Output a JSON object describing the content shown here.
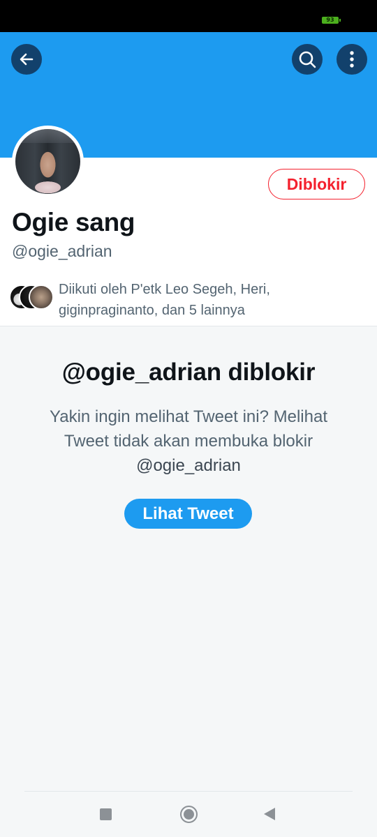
{
  "status_bar": {
    "battery_level": "93"
  },
  "colors": {
    "brand_blue": "#1d9bf0",
    "blocked_red": "#f4212e",
    "secondary_text": "#536471"
  },
  "header": {
    "back_icon": "arrow-left-icon",
    "search_icon": "search-icon",
    "more_icon": "more-vertical-icon"
  },
  "profile": {
    "display_name": "Ogie sang",
    "handle": "@ogie_adrian",
    "blocked_button_label": "Diblokir",
    "followed_by_text": "Diikuti oleh P'etk Leo Segeh, Heri, giginpraginanto, dan 5 lainnya"
  },
  "blocked_notice": {
    "title": "@ogie_adrian diblokir",
    "description": "Yakin ingin melihat Tweet ini? Melihat Tweet tidak akan membuka blokir",
    "description_handle": "@ogie_adrian",
    "view_button_label": "Lihat Tweet"
  },
  "nav": {
    "recents_icon": "square-icon",
    "home_icon": "circle-home-icon",
    "back_icon": "triangle-back-icon"
  }
}
